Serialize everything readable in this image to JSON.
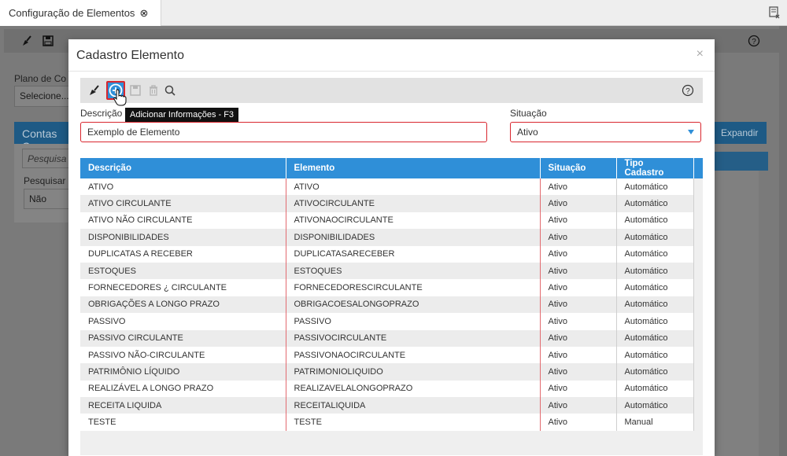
{
  "tabs": [
    {
      "label": "Configuração de Elementos",
      "close": "⊗"
    }
  ],
  "background": {
    "plano_label": "Plano de Co",
    "plano_value": "Selecione...",
    "panel_title": "Contas C",
    "search_placeholder": "Pesquisa",
    "pesquisar_label": "Pesquisar",
    "pesquisar_value": "Não",
    "expand_label": "Expandir"
  },
  "modal": {
    "title": "Cadastro Elemento",
    "close": "×",
    "tooltip": "Adicionar Informações - F3",
    "descricao_label": "Descrição",
    "descricao_value": "Exemplo de Elemento",
    "situacao_label": "Situação",
    "situacao_value": "Ativo"
  },
  "grid": {
    "columns": [
      "Descrição",
      "Elemento",
      "Situação",
      "Tipo Cadastro"
    ],
    "rows": [
      [
        "ATIVO",
        "ATIVO",
        "Ativo",
        "Automático"
      ],
      [
        "ATIVO CIRCULANTE",
        "ATIVOCIRCULANTE",
        "Ativo",
        "Automático"
      ],
      [
        "ATIVO NÃO CIRCULANTE",
        "ATIVONAOCIRCULANTE",
        "Ativo",
        "Automático"
      ],
      [
        "DISPONIBILIDADES",
        "DISPONIBILIDADES",
        "Ativo",
        "Automático"
      ],
      [
        "DUPLICATAS A RECEBER",
        "DUPLICATASARECEBER",
        "Ativo",
        "Automático"
      ],
      [
        "ESTOQUES",
        "ESTOQUES",
        "Ativo",
        "Automático"
      ],
      [
        "FORNECEDORES ¿ CIRCULANTE",
        "FORNECEDORESCIRCULANTE",
        "Ativo",
        "Automático"
      ],
      [
        "OBRIGAÇÕES A LONGO PRAZO",
        "OBRIGACOESALONGOPRAZO",
        "Ativo",
        "Automático"
      ],
      [
        "PASSIVO",
        "PASSIVO",
        "Ativo",
        "Automático"
      ],
      [
        "PASSIVO CIRCULANTE",
        "PASSIVOCIRCULANTE",
        "Ativo",
        "Automático"
      ],
      [
        "PASSIVO NÃO-CIRCULANTE",
        "PASSIVONAOCIRCULANTE",
        "Ativo",
        "Automático"
      ],
      [
        "PATRIMÔNIO LÍQUIDO",
        "PATRIMONIOLIQUIDO",
        "Ativo",
        "Automático"
      ],
      [
        "REALIZÁVEL A LONGO PRAZO",
        "REALIZAVELALONGOPRAZO",
        "Ativo",
        "Automático"
      ],
      [
        "RECEITA LIQUIDA",
        "RECEITALIQUIDA",
        "Ativo",
        "Automático"
      ],
      [
        "TESTE",
        "TESTE",
        "Ativo",
        "Manual"
      ]
    ]
  },
  "icons": {
    "clear": "broom-icon",
    "add": "plus-circle-icon",
    "save": "save-icon",
    "delete": "trash-icon",
    "search": "search-icon",
    "help": "help-circle-icon"
  },
  "colors": {
    "accent": "#2f8fd8",
    "error_border": "#d9262e"
  }
}
